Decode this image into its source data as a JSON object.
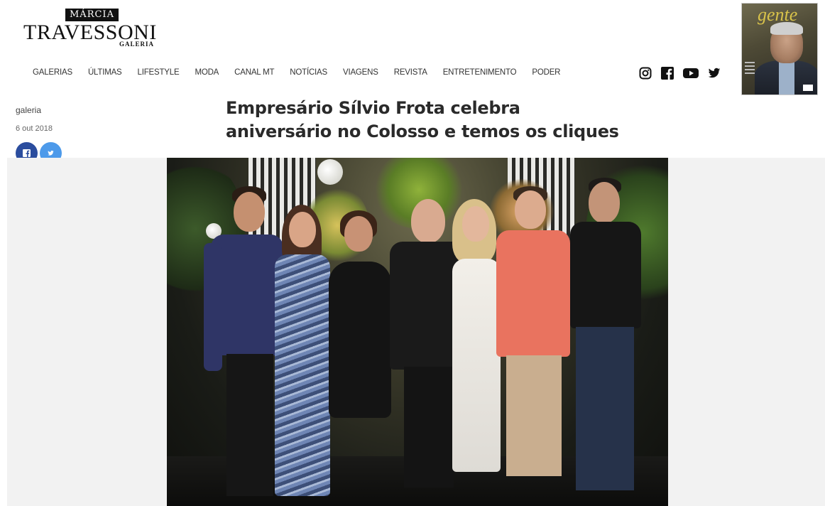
{
  "logo": {
    "top": "MÁRCIA",
    "main": "TRAVESSONI",
    "sub": "GALERIA"
  },
  "nav": [
    "GALERIAS",
    "ÚLTIMAS",
    "LIFESTYLE",
    "MODA",
    "CANAL MT",
    "NOTÍCIAS",
    "VIAGENS",
    "REVISTA",
    "ENTRETENIMENTO",
    "PODER"
  ],
  "social": [
    "instagram-icon",
    "facebook-icon",
    "youtube-icon",
    "twitter-icon"
  ],
  "magazine": {
    "title": "gente"
  },
  "article": {
    "category": "galeria",
    "date": "6 out 2018",
    "title_line1": "Empresário Sílvio Frota celebra",
    "title_line2": "aniversário no Colosso e temos os cliques"
  },
  "share": {
    "facebook_icon": "facebook-icon",
    "twitter_icon": "twitter-icon",
    "facebook_color": "#2b4d9e",
    "twitter_color": "#4d9aea"
  }
}
